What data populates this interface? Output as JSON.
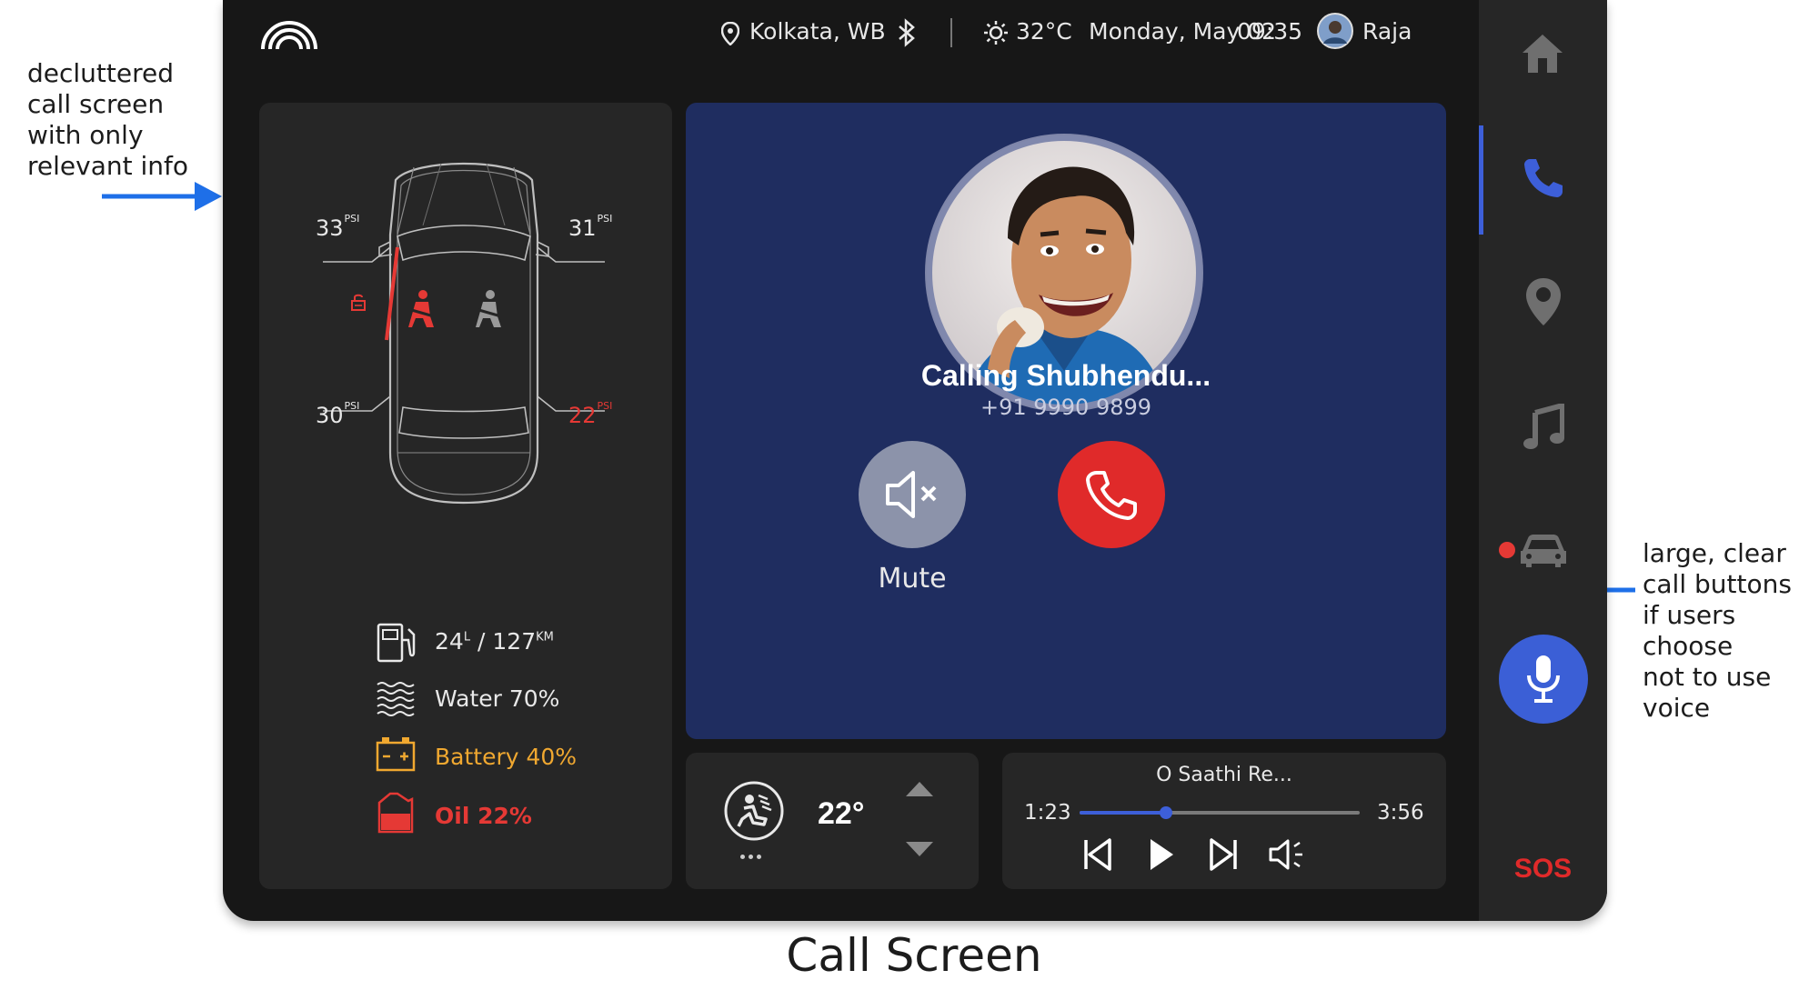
{
  "annotations": {
    "left_note": "decluttered\ncall screen\nwith only\nrelevant info",
    "right_note": "large, clear\ncall buttons\nif users choose\nnot to use voice",
    "caption": "Call Screen"
  },
  "topbar": {
    "location": "Kolkata, WB",
    "temperature": "32°C",
    "date": "Monday, May 02",
    "time": "09:35",
    "user": "Raja"
  },
  "vehicle": {
    "tyres": {
      "front_left": "33",
      "front_right": "31",
      "rear_left": "30",
      "rear_right": "22",
      "unit": "PSI"
    },
    "fuel": {
      "litres": "24",
      "litres_unit": "L",
      "range": "127",
      "range_unit": "KM"
    },
    "water": "Water 70%",
    "battery": "Battery 40%",
    "oil": "Oil 22%"
  },
  "call": {
    "title": "Calling Shubhendu...",
    "number": "+91 9990 9899",
    "mute_label": "Mute"
  },
  "climate": {
    "temperature": "22°"
  },
  "media": {
    "track": "O Saathi Re...",
    "elapsed": "1:23",
    "duration": "3:56",
    "progress": 0.31
  },
  "sidebar": {
    "sos_label": "SOS"
  },
  "colors": {
    "accent_blue": "#3d5fd9",
    "alert_red": "#e53935",
    "battery_amber": "#f0a830",
    "call_panel": "#1f2d60"
  },
  "icons": [
    "signal-arc-logo-icon",
    "location-pin-icon",
    "bluetooth-icon",
    "sun-icon",
    "home-icon",
    "phone-icon",
    "map-pin-icon",
    "music-icon",
    "car-icon",
    "microphone-icon",
    "fuel-icon",
    "water-icon",
    "battery-icon",
    "oil-icon",
    "fan-icon",
    "triangle-up-icon",
    "triangle-down-icon",
    "prev-track-icon",
    "play-icon",
    "next-track-icon",
    "volume-icon",
    "mute-icon",
    "end-call-icon",
    "seatbelt-icon",
    "unlocked-door-icon"
  ]
}
